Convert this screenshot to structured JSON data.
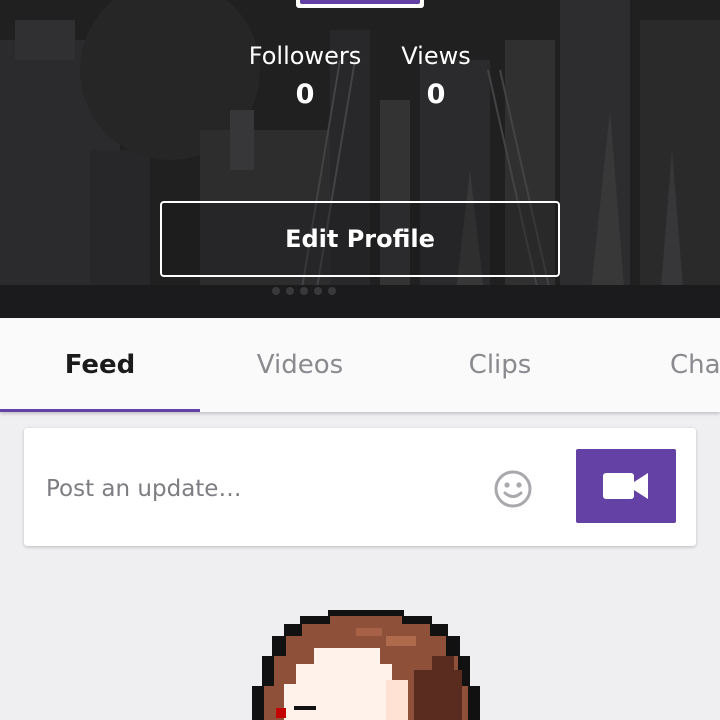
{
  "profile": {
    "stats": [
      {
        "label": "Followers",
        "value": "0"
      },
      {
        "label": "Views",
        "value": "0"
      }
    ],
    "edit_profile_label": "Edit Profile"
  },
  "tabs": [
    {
      "label": "Feed",
      "active": true
    },
    {
      "label": "Videos",
      "active": false
    },
    {
      "label": "Clips",
      "active": false
    },
    {
      "label": "Cha",
      "active": false
    }
  ],
  "composer": {
    "placeholder": "Post an update…",
    "emoji_icon": "smiley-face-icon",
    "video_icon": "video-camera-icon"
  },
  "colors": {
    "accent": "#6441a5",
    "banner_bg": "#2d2d2f",
    "page_bg": "#efeef1",
    "tab_active_text": "#1b1b1b",
    "tab_inactive_text": "#8a8a8f"
  }
}
